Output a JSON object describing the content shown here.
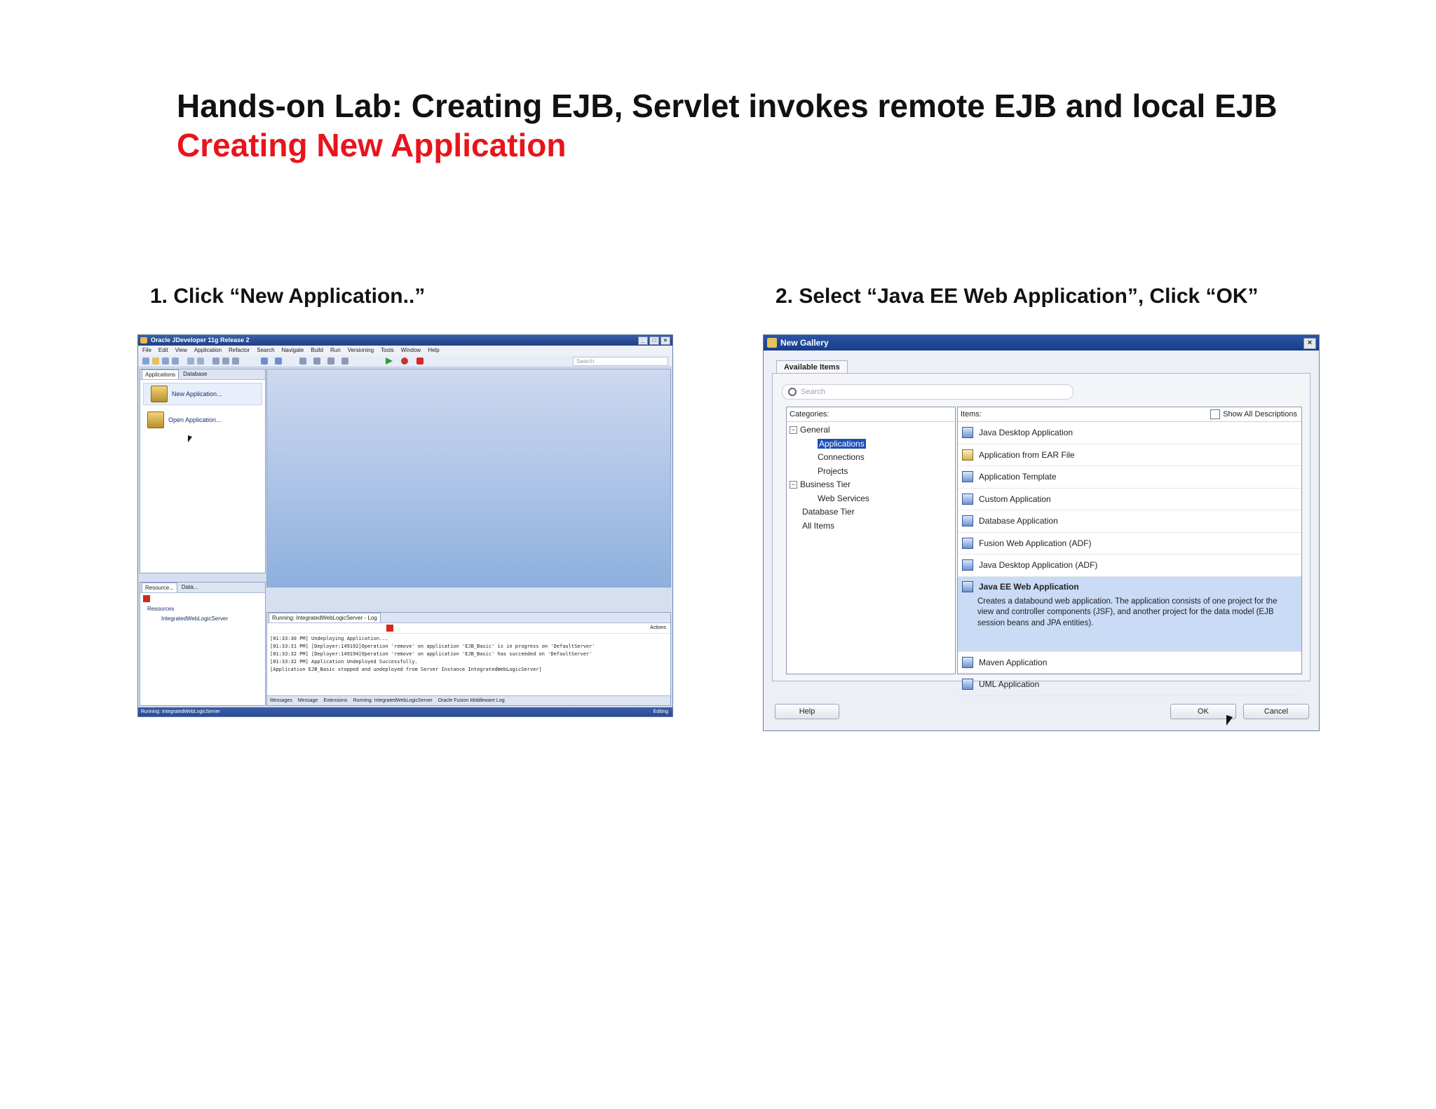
{
  "slide": {
    "title": "Hands-on Lab: Creating EJB, Servlet invokes remote EJB and local EJB",
    "subtitle": "Creating New Application",
    "step1": "1. Click “New Application..”",
    "step2": "2. Select “Java EE Web Application”, Click “OK”"
  },
  "jdev": {
    "title": "Oracle JDeveloper 11g Release 2",
    "window_buttons": [
      "_",
      "□",
      "×"
    ],
    "menu": [
      "File",
      "Edit",
      "View",
      "Application",
      "Refactor",
      "Search",
      "Navigate",
      "Build",
      "Run",
      "Versioning",
      "Tools",
      "Window",
      "Help"
    ],
    "search_placeholder": "Search",
    "apps_tabs": [
      "Applications",
      "Database"
    ],
    "new_app_label": "New Application...",
    "open_app_label": "Open Application...",
    "resources_tabs": [
      "Resource...",
      "Data..."
    ],
    "resources_items": [
      "Resources",
      "IntegratedWebLogicServer"
    ],
    "log_tab": "Running: IntegratedWebLogicServer - Log",
    "log_actions": "Actions",
    "log_lines": [
      "[01:33:30 PM] Undeploying Application...",
      "[01:33:31 PM] [Deployer:149192]Operation 'remove' on application 'EJB_Basic' is in progress on 'DefaultServer'",
      "[01:33:32 PM] [Deployer:149194]Operation 'remove' on application 'EJB_Basic' has succeeded on 'DefaultServer'",
      "[01:33:32 PM] Application Undeployed Successfully.",
      "[Application EJB_Basic stopped and undeployed from Server Instance IntegratedWebLogicServer]"
    ],
    "log_bottom_tabs": [
      "Messages",
      "Message",
      "Extensions",
      "Running: IntegratedWebLogicServer",
      "Oracle Fusion Middleware Log"
    ],
    "status": "Running: IntegratedWebLogicServer",
    "status_right": "Editing"
  },
  "gallery": {
    "title": "New Gallery",
    "close": "×",
    "tab": "Available Items",
    "search_placeholder": "Search",
    "categories_header": "Categories:",
    "items_header": "Items:",
    "show_all": "Show All Descriptions",
    "categories": [
      {
        "label": "General",
        "level": 0,
        "expander": "−"
      },
      {
        "label": "Applications",
        "level": 1,
        "selected": true
      },
      {
        "label": "Connections",
        "level": 1
      },
      {
        "label": "Projects",
        "level": 1
      },
      {
        "label": "Business Tier",
        "level": 0,
        "expander": "−"
      },
      {
        "label": "Web Services",
        "level": 1
      },
      {
        "label": "Database Tier",
        "level": 0
      },
      {
        "label": "All Items",
        "level": 0
      }
    ],
    "items": [
      "Java Desktop Application",
      "Application from EAR File",
      "Application Template",
      "Custom Application",
      "Database Application",
      "Fusion Web Application (ADF)",
      "Java Desktop Application (ADF)"
    ],
    "selected_item": "Java EE Web Application",
    "selected_desc": "Creates a databound web application. The application consists of one project for the view and controller components (JSF), and another project for the data model (EJB session beans and JPA entities).",
    "items_after": [
      "Maven Application",
      "UML Application"
    ],
    "help": "Help",
    "ok": "OK",
    "cancel": "Cancel"
  }
}
